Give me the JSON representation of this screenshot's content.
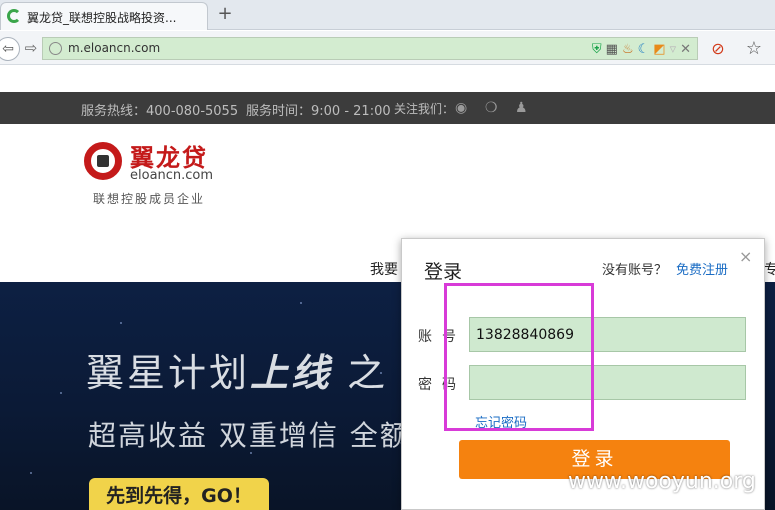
{
  "browser": {
    "tab_title": "翼龙贷_联想控股战略投资...",
    "new_tab_glyph": "+",
    "url": "m.eloancn.com",
    "back_glyph": "⇦",
    "forward_glyph": "⇨"
  },
  "topbar": {
    "hotline": "服务热线：400-080-5055",
    "service_time": "服务时间：9:00 - 21:00",
    "follow": "关注我们："
  },
  "logo": {
    "name": "翼龙贷",
    "domain": "eloancn.com",
    "subtitle": "联想控股成员企业"
  },
  "nav": {
    "partial_left": "我要",
    "partial_right": "专"
  },
  "banner": {
    "title_a": "翼星计划",
    "title_b": "上线",
    "title_c": "  之",
    "subtitle": "超高收益 双重增信 全额",
    "cta": "先到先得，GO！"
  },
  "login": {
    "title": "登录",
    "close": "×",
    "no_account": "没有账号？",
    "register": "免费注册",
    "account_label": "账号",
    "account_value": "13828840869",
    "password_label": "密码",
    "password_value": "",
    "forgot": "忘记密码",
    "submit": "登录"
  },
  "watermark": "www.wooyun.org",
  "colors": {
    "accent_orange": "#f5820f",
    "link_blue": "#1a6cc4",
    "brand_red": "#c41a1a",
    "highlight_magenta": "#d83bd8"
  }
}
